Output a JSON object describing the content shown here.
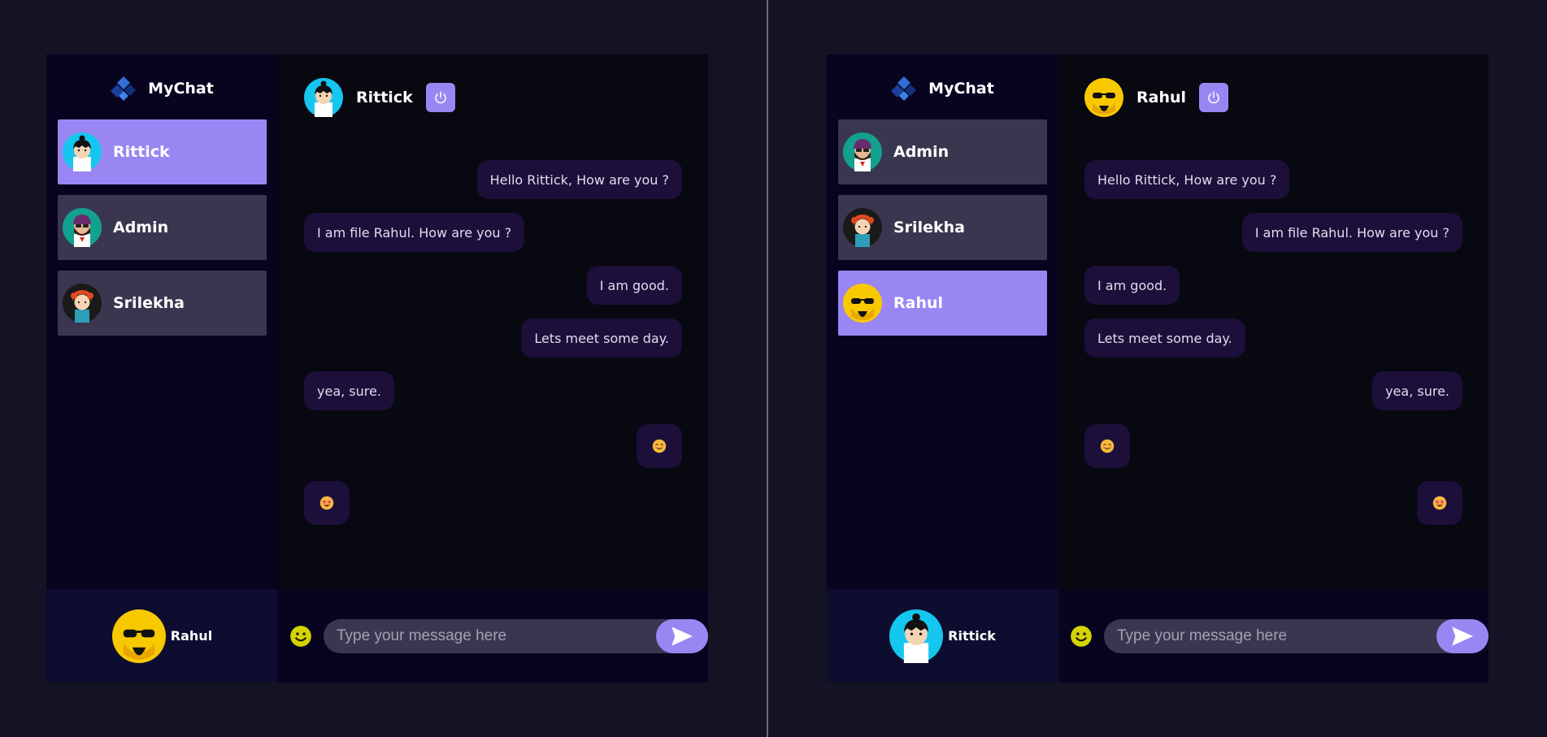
{
  "colors": {
    "background": "#131324",
    "accent": "#9a86f3",
    "contact_bg": "#3a3650",
    "bubble_bg": "#1c0f3a",
    "sidebar_bg": "#080420",
    "current_user_bg": "#0d0d30"
  },
  "panels": [
    {
      "brand": {
        "name": "MyChat",
        "icon": "diamond-logo-icon"
      },
      "contacts": [
        {
          "name": "Rittick",
          "avatar": "rittick",
          "selected": true
        },
        {
          "name": "Admin",
          "avatar": "admin",
          "selected": false
        },
        {
          "name": "Srilekha",
          "avatar": "srilekha",
          "selected": false
        }
      ],
      "current_user": {
        "name": "Rahul",
        "avatar": "rahul"
      },
      "chat_header": {
        "name": "Rittick",
        "avatar": "rittick",
        "logout_icon": "power-icon"
      },
      "messages": [
        {
          "text": "Hello Rittick, How are you ?",
          "dir": "sent"
        },
        {
          "text": "I am file Rahul. How are you ?",
          "dir": "recv"
        },
        {
          "text": "I am good.",
          "dir": "sent"
        },
        {
          "text": "Lets meet some day.",
          "dir": "sent"
        },
        {
          "text": "yea, sure.",
          "dir": "recv"
        },
        {
          "emoji": "smiling-face-emoji",
          "dir": "sent"
        },
        {
          "emoji": "star-struck-face-emoji",
          "dir": "recv"
        }
      ],
      "input": {
        "placeholder": "Type your message here",
        "value": ""
      }
    },
    {
      "brand": {
        "name": "MyChat",
        "icon": "diamond-logo-icon"
      },
      "contacts": [
        {
          "name": "Admin",
          "avatar": "admin",
          "selected": false
        },
        {
          "name": "Srilekha",
          "avatar": "srilekha",
          "selected": false
        },
        {
          "name": "Rahul",
          "avatar": "rahul",
          "selected": true
        }
      ],
      "current_user": {
        "name": "Rittick",
        "avatar": "rittick"
      },
      "chat_header": {
        "name": "Rahul",
        "avatar": "rahul",
        "logout_icon": "power-icon"
      },
      "messages": [
        {
          "text": "Hello Rittick, How are you ?",
          "dir": "recv"
        },
        {
          "text": "I am file Rahul. How are you ?",
          "dir": "sent"
        },
        {
          "text": "I am good.",
          "dir": "recv"
        },
        {
          "text": "Lets meet some day.",
          "dir": "recv"
        },
        {
          "text": "yea, sure.",
          "dir": "sent"
        },
        {
          "emoji": "smiling-face-emoji",
          "dir": "recv"
        },
        {
          "emoji": "star-struck-face-emoji",
          "dir": "sent"
        }
      ],
      "input": {
        "placeholder": "Type your message here",
        "value": ""
      }
    }
  ]
}
